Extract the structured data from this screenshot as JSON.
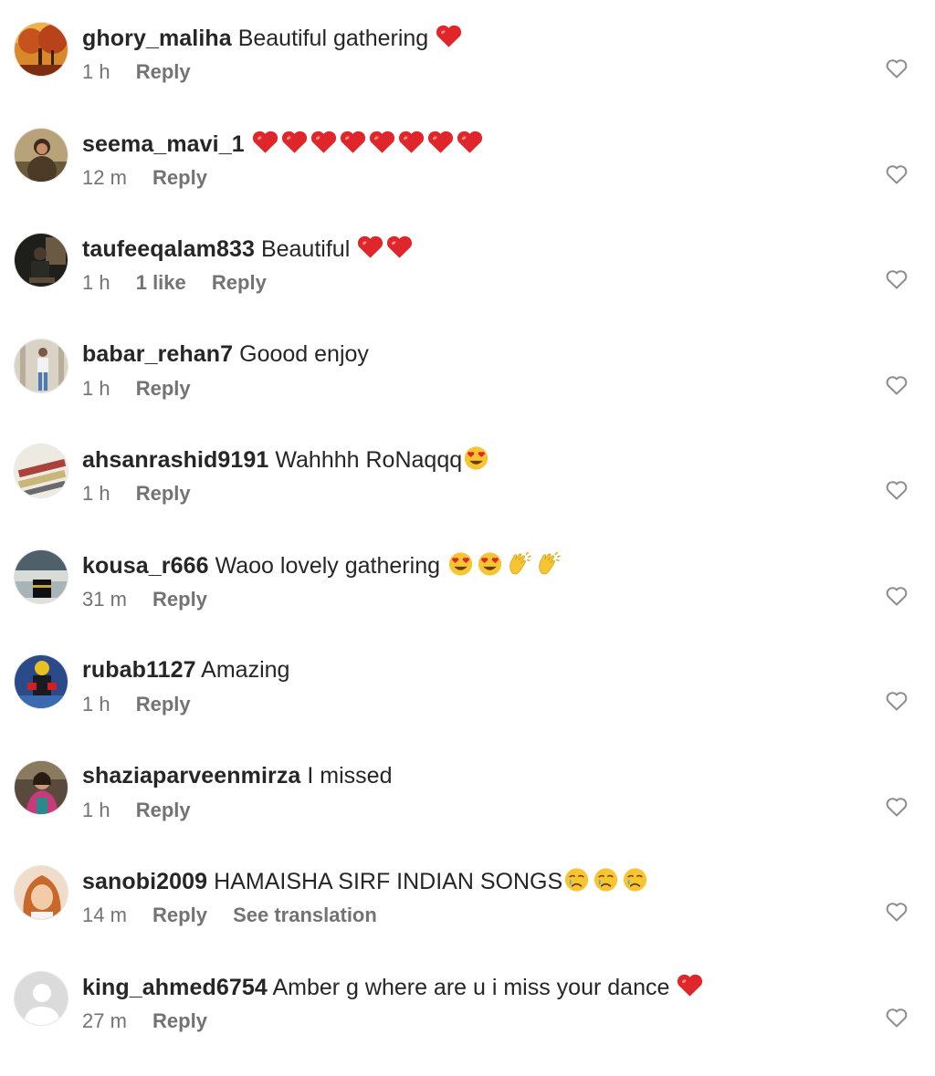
{
  "colors": {
    "text": "#262626",
    "meta": "#737373",
    "heart": "#e0252b",
    "like_outline": "#8e8e8e"
  },
  "comments": [
    {
      "username": "ghory_maliha",
      "text": "Beautiful gathering",
      "emojis": [
        "red-heart"
      ],
      "time": "1 h",
      "likes": "",
      "reply": "Reply",
      "translate": "",
      "avatar": "autumn-trees-photo"
    },
    {
      "username": "seema_mavi_1",
      "text": "",
      "emojis": [
        "red-heart",
        "red-heart",
        "red-heart",
        "red-heart",
        "red-heart",
        "red-heart",
        "red-heart",
        "red-heart"
      ],
      "time": "12 m",
      "likes": "",
      "reply": "Reply",
      "translate": "",
      "avatar": "woman-portrait-photo"
    },
    {
      "username": "taufeeqalam833",
      "text": "Beautiful",
      "emojis": [
        "red-heart",
        "red-heart"
      ],
      "time": "1 h",
      "likes": "1 like",
      "reply": "Reply",
      "translate": "",
      "avatar": "dark-man-photo"
    },
    {
      "username": "babar_rehan7",
      "text": "Goood enjoy",
      "emojis": [],
      "time": "1 h",
      "likes": "",
      "reply": "Reply",
      "translate": "",
      "avatar": "man-standing-photo"
    },
    {
      "username": "ahsanrashid9191",
      "text": "Wahhhh RoNaqqq",
      "emojis": [
        "heart-eyes"
      ],
      "time": "1 h",
      "likes": "",
      "reply": "Reply",
      "translate": "",
      "avatar": "pens-photo"
    },
    {
      "username": "kousa_r666",
      "text": "Waoo lovely gathering",
      "emojis": [
        "heart-eyes",
        "heart-eyes",
        "clapping-hands",
        "clapping-hands"
      ],
      "time": "31 m",
      "likes": "",
      "reply": "Reply",
      "translate": "",
      "avatar": "kaaba-photo"
    },
    {
      "username": "rubab1127",
      "text": "Amazing",
      "emojis": [],
      "time": "1 h",
      "likes": "",
      "reply": "Reply",
      "translate": "",
      "avatar": "superhero-photo"
    },
    {
      "username": "shaziaparveenmirza",
      "text": "I missed",
      "emojis": [],
      "time": "1 h",
      "likes": "",
      "reply": "Reply",
      "translate": "",
      "avatar": "woman-colorful-photo"
    },
    {
      "username": "sanobi2009",
      "text": "HAMAISHA SIRF INDIAN SONGS",
      "emojis": [
        "crying-face",
        "crying-face",
        "crying-face"
      ],
      "time": "14 m",
      "likes": "",
      "reply": "Reply",
      "translate": "See translation",
      "avatar": "girl-portrait-photo"
    },
    {
      "username": "king_ahmed6754",
      "text": "Amber g where are u i miss your dance",
      "emojis": [
        "red-heart"
      ],
      "time": "27 m",
      "likes": "",
      "reply": "Reply",
      "translate": "",
      "avatar": "default-user-silhouette"
    }
  ]
}
